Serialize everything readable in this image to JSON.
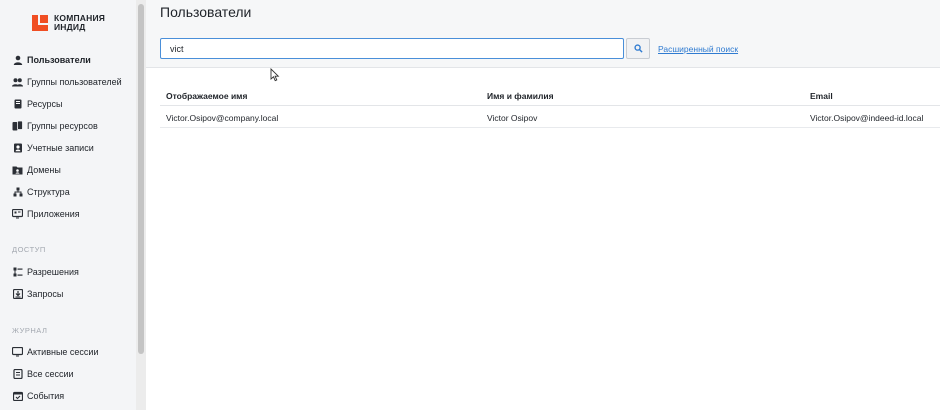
{
  "company": {
    "line1": "КОМПАНИЯ",
    "line2": "ИНДИД"
  },
  "sidebar": {
    "items": [
      {
        "label": "Пользователи",
        "icon": "user-icon",
        "active": true
      },
      {
        "label": "Группы пользователей",
        "icon": "users-icon"
      },
      {
        "label": "Ресурсы",
        "icon": "resource-icon"
      },
      {
        "label": "Группы ресурсов",
        "icon": "resource-group-icon"
      },
      {
        "label": "Учетные записи",
        "icon": "account-icon"
      },
      {
        "label": "Домены",
        "icon": "domain-icon"
      },
      {
        "label": "Структура",
        "icon": "structure-icon"
      },
      {
        "label": "Приложения",
        "icon": "app-icon"
      }
    ],
    "access_section": "ДОСТУП",
    "access_items": [
      {
        "label": "Разрешения",
        "icon": "permissions-icon"
      },
      {
        "label": "Запросы",
        "icon": "requests-icon"
      }
    ],
    "journal_section": "ЖУРНАЛ",
    "journal_items": [
      {
        "label": "Активные сессии",
        "icon": "monitor-icon"
      },
      {
        "label": "Все сессии",
        "icon": "sessions-icon"
      },
      {
        "label": "События",
        "icon": "events-icon"
      }
    ]
  },
  "header": {
    "title": "Пользователи",
    "search_value": "vict",
    "advanced_search": "Расширенный поиск"
  },
  "table": {
    "columns": [
      "Отображаемое имя",
      "Имя и фамилия",
      "Email"
    ],
    "rows": [
      [
        "Victor.Osipov@company.local",
        "Victor Osipov",
        "Victor.Osipov@indeed-id.local"
      ]
    ]
  },
  "colors": {
    "brand": "#f04e23",
    "accent": "#2f7bd1",
    "input_border": "#4a8fd9"
  }
}
